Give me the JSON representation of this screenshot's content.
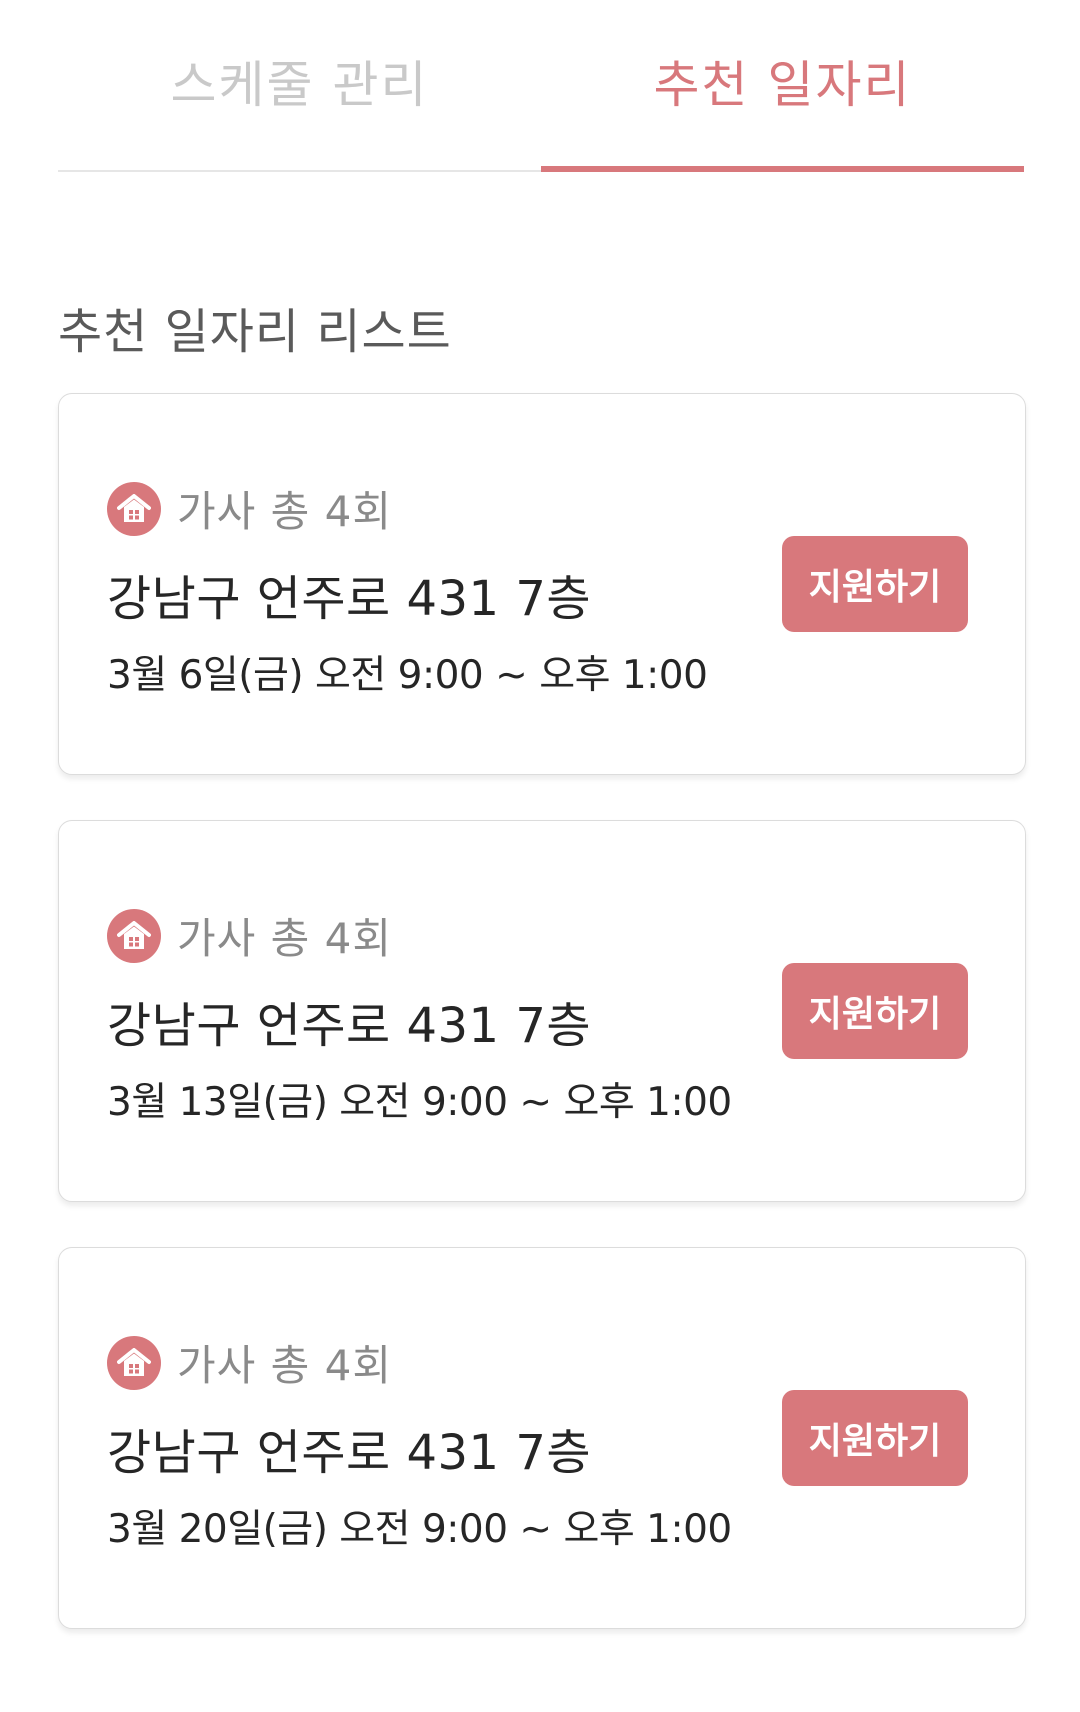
{
  "tabs": [
    {
      "label": "스케줄 관리",
      "active": false
    },
    {
      "label": "추천 일자리",
      "active": true
    }
  ],
  "section": {
    "title": "추천 일자리 리스트"
  },
  "jobs": [
    {
      "icon": "home-icon",
      "type": "가사 총 4회",
      "address": "강남구 언주로 431 7층",
      "datetime": "3월 6일(금) 오전 9:00 ~ 오후 1:00",
      "apply_label": "지원하기"
    },
    {
      "icon": "home-icon",
      "type": "가사 총 4회",
      "address": "강남구 언주로 431 7층",
      "datetime": "3월 13일(금) 오전 9:00 ~ 오후 1:00",
      "apply_label": "지원하기"
    },
    {
      "icon": "home-icon",
      "type": "가사 총 4회",
      "address": "강남구 언주로 431 7층",
      "datetime": "3월 20일(금) 오전 9:00 ~ 오후 1:00",
      "apply_label": "지원하기"
    }
  ],
  "colors": {
    "accent": "#d8787c",
    "inactive_tab": "#c9c9c9",
    "text_primary": "#262626",
    "text_secondary": "#8a8a8a"
  }
}
